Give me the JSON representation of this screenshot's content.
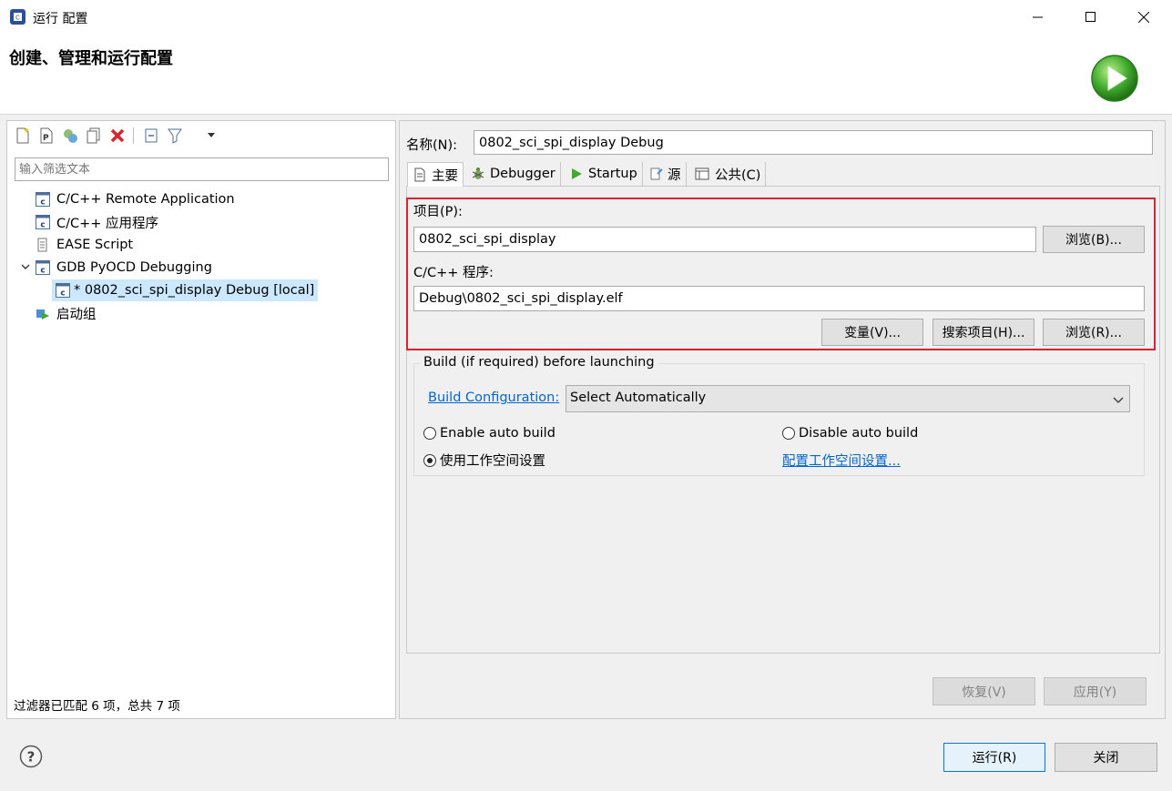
{
  "window": {
    "title": "运行 配置"
  },
  "header": {
    "title": "创建、管理和运行配置"
  },
  "left": {
    "filter_placeholder": "输入筛选文本",
    "tree": [
      {
        "label": "C/C++ Remote Application"
      },
      {
        "label": "C/C++ 应用程序"
      },
      {
        "label": "EASE Script"
      },
      {
        "label": "GDB PyOCD Debugging"
      },
      {
        "label": "* 0802_sci_spi_display Debug [local]"
      },
      {
        "label": "启动组"
      }
    ],
    "status": "过滤器已匹配 6 项，总共 7 项"
  },
  "right": {
    "name_label": "名称(N):",
    "name_value": "0802_sci_spi_display Debug",
    "tabs": [
      {
        "label": "主要"
      },
      {
        "label": "Debugger"
      },
      {
        "label": "Startup"
      },
      {
        "label": "源"
      },
      {
        "label": "公共(C)"
      }
    ],
    "project_label": "项目(P):",
    "project_value": "0802_sci_spi_display",
    "browse_b": "浏览(B)...",
    "program_label": "C/C++ 程序:",
    "program_value": "Debug\\0802_sci_spi_display.elf",
    "variables_btn": "变量(V)...",
    "search_btn": "搜索项目(H)...",
    "browse_r": "浏览(R)...",
    "build_group": "Build (if required) before launching",
    "build_config_label": "Build Configuration:",
    "build_config_value": "Select Automatically",
    "enable_auto": "Enable auto build",
    "disable_auto": "Disable auto build",
    "use_workspace": "使用工作空间设置",
    "config_workspace": "配置工作空间设置...",
    "revert_btn": "恢复(V)",
    "apply_btn": "应用(Y)"
  },
  "footer": {
    "run_btn": "运行(R)",
    "close_btn": "关闭"
  },
  "colors": {
    "highlight_border": "#e0202e",
    "selection_bg": "#cce8ff",
    "link": "#0066cc"
  }
}
